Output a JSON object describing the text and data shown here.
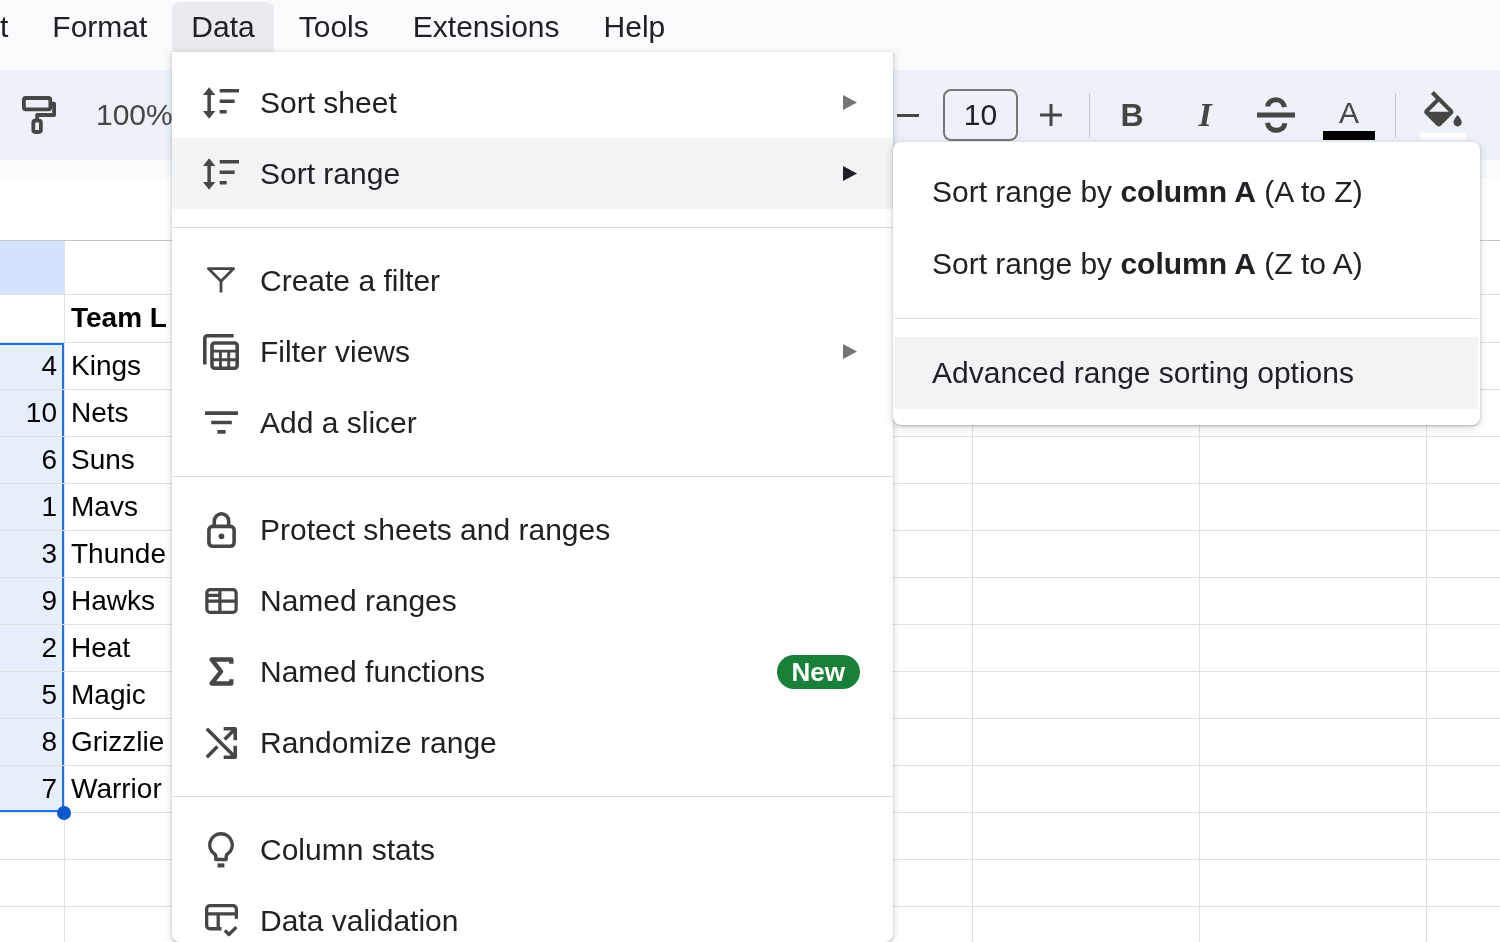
{
  "menu_bar": {
    "items": [
      {
        "label": "t",
        "selected": false
      },
      {
        "label": "Format",
        "selected": false
      },
      {
        "label": "Data",
        "selected": true
      },
      {
        "label": "Tools",
        "selected": false
      },
      {
        "label": "Extensions",
        "selected": false
      },
      {
        "label": "Help",
        "selected": false
      }
    ]
  },
  "toolbar": {
    "zoom": "100%",
    "font_size": "10",
    "format_buttons": [
      {
        "kind": "bold",
        "label": "B"
      },
      {
        "kind": "italic",
        "label": "I"
      },
      {
        "kind": "strikethrough"
      },
      {
        "kind": "textcolor",
        "label": "A"
      }
    ]
  },
  "sheet": {
    "header": {
      "column_2": "Team L"
    },
    "rows": [
      {
        "column_1": "4",
        "column_2": "Kings",
        "selected": true
      },
      {
        "column_1": "10",
        "column_2": "Nets",
        "selected": true
      },
      {
        "column_1": "6",
        "column_2": "Suns",
        "selected": true
      },
      {
        "column_1": "1",
        "column_2": "Mavs",
        "selected": true
      },
      {
        "column_1": "3",
        "column_2": "Thunde",
        "selected": true
      },
      {
        "column_1": "9",
        "column_2": "Hawks",
        "selected": true
      },
      {
        "column_1": "2",
        "column_2": "Heat",
        "selected": true
      },
      {
        "column_1": "5",
        "column_2": "Magic",
        "selected": true
      },
      {
        "column_1": "8",
        "column_2": "Grizzlie",
        "selected": true
      },
      {
        "column_1": "7",
        "column_2": "Warrior",
        "selected": true
      }
    ]
  },
  "data_menu": {
    "groups": [
      {
        "items": [
          {
            "kind": "sort",
            "label": "Sort sheet",
            "submenu": true,
            "highlighted": false
          },
          {
            "kind": "sort",
            "label": "Sort range",
            "submenu": true,
            "highlighted": true
          }
        ]
      },
      {
        "items": [
          {
            "kind": "filter",
            "label": "Create a filter",
            "submenu": false,
            "highlighted": false
          },
          {
            "kind": "filterviews",
            "label": "Filter views",
            "submenu": true,
            "highlighted": false
          },
          {
            "kind": "slicer",
            "label": "Add a slicer",
            "submenu": false,
            "highlighted": false
          }
        ]
      },
      {
        "items": [
          {
            "kind": "protect",
            "label": "Protect sheets and ranges",
            "submenu": false,
            "highlighted": false
          },
          {
            "kind": "namedranges",
            "label": "Named ranges",
            "submenu": false,
            "highlighted": false
          },
          {
            "kind": "functions",
            "label": "Named functions",
            "submenu": false,
            "highlighted": false,
            "badge": "New"
          },
          {
            "kind": "randomize",
            "label": "Randomize range",
            "submenu": false,
            "highlighted": false
          }
        ]
      },
      {
        "items": [
          {
            "kind": "stats",
            "label": "Column stats",
            "submenu": false,
            "highlighted": false
          },
          {
            "kind": "validation",
            "label": "Data validation",
            "submenu": false,
            "highlighted": false
          }
        ]
      }
    ]
  },
  "sort_range_submenu": {
    "groups": [
      {
        "items": [
          {
            "label": "Sort range by **column A** (A to Z)",
            "highlighted": false
          },
          {
            "label": "Sort range by **column A** (Z to A)",
            "highlighted": false
          }
        ]
      },
      {
        "items": [
          {
            "label": "Advanced range sorting options",
            "highlighted": true
          }
        ]
      }
    ]
  }
}
